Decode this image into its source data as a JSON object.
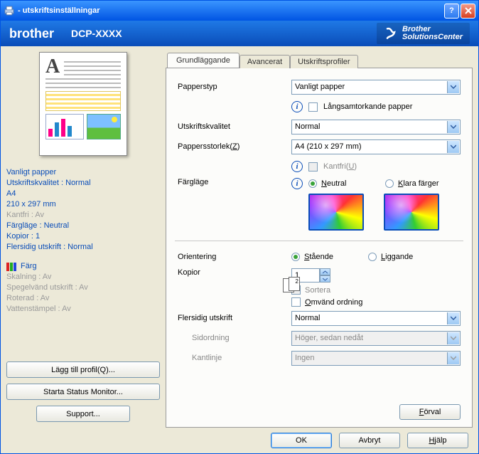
{
  "window": {
    "title": " - utskriftsinställningar"
  },
  "brand": {
    "logo": "brother",
    "model": "DCP-XXXX",
    "sc_line1": "Brother",
    "sc_line2": "SolutionsCenter"
  },
  "tabs": {
    "basic": "Grundläggande",
    "advanced": "Avancerat",
    "profiles": "Utskriftsprofiler"
  },
  "left": {
    "line1": "Vanligt papper",
    "line2": "Utskriftskvalitet : Normal",
    "line3": "A4",
    "line4": "210 x 297 mm",
    "line5": "Kantfri : Av",
    "line6": "Färgläge : Neutral",
    "line7": "Kopior : 1",
    "line8": "Flersidig utskrift : Normal",
    "color_label": "Färg",
    "dim1": "Skalning : Av",
    "dim2": "Spegelvänd utskrift : Av",
    "dim3": "Roterad : Av",
    "dim4": "Vattenstämpel : Av",
    "btn_addprofile": "Lägg till profil(Q)...",
    "btn_status": "Starta Status Monitor...",
    "btn_support": "Support..."
  },
  "form": {
    "papertype_label": "Papperstyp",
    "papertype_value": "Vanligt papper",
    "slowdry_label": "Långsamtorkande papper",
    "quality_label": "Utskriftskvalitet",
    "quality_value": "Normal",
    "size_label": "Pappersstorlek(Z)",
    "size_value": "A4 (210 x 297 mm)",
    "borderless_label": "Kantfri(U)",
    "colormode_label": "Färgläge",
    "colormode_opt1": "Neutral",
    "colormode_opt2": "Klara färger",
    "orientation_label": "Orientering",
    "orientation_opt1": "Stående",
    "orientation_opt2": "Liggande",
    "copies_label": "Kopior",
    "copies_value": "1",
    "collate_label": "Sortera",
    "reverse_label": "Omvänd ordning",
    "multipage_label": "Flersidig utskrift",
    "multipage_value": "Normal",
    "pageorder_label": "Sidordning",
    "pageorder_value": "Höger, sedan nedåt",
    "borderline_label": "Kantlinje",
    "borderline_value": "Ingen",
    "defaults_btn": "Förval"
  },
  "footer": {
    "ok": "OK",
    "cancel": "Avbryt",
    "help": "Hjälp"
  }
}
